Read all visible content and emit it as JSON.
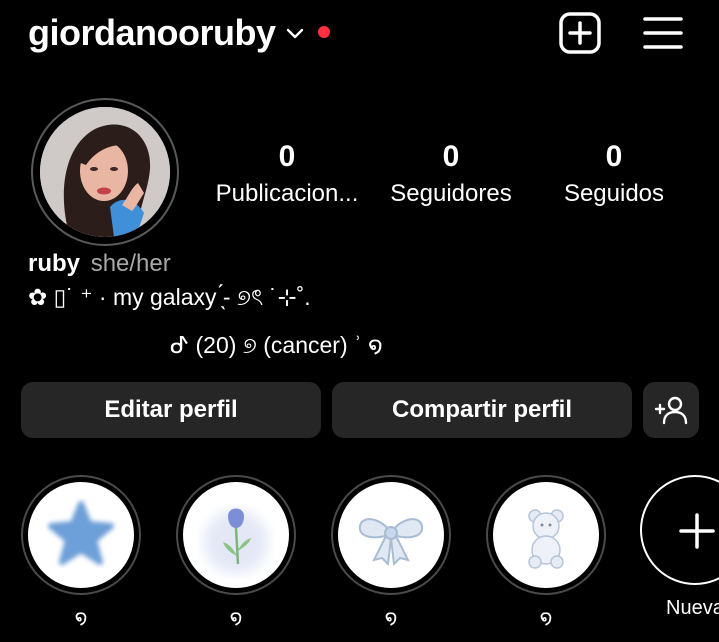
{
  "header": {
    "username": "giordanooruby",
    "icons": [
      "chevron-down-icon",
      "notification-dot",
      "add-post-icon",
      "menu-icon"
    ],
    "accent_color": "#ff3040"
  },
  "profile": {
    "stats": [
      {
        "value": "0",
        "label": "Publicacion..."
      },
      {
        "value": "0",
        "label": "Seguidores"
      },
      {
        "value": "0",
        "label": "Seguidos"
      }
    ],
    "bio": {
      "name": "ruby",
      "pronouns": "she/her",
      "line1": "✿ ▯˙ ⁺ · my galaxy ̖́- ୭ৎ ˙⊹˚.",
      "line2": "ᕷ (20) ୭ (cancer) ʾ ໑"
    }
  },
  "actions": {
    "edit_label": "Editar perfil",
    "share_label": "Compartir perfil",
    "add_user_icon": "add-person-icon"
  },
  "highlights": {
    "items": [
      {
        "label": "໑",
        "icon": "blue-star-icon"
      },
      {
        "label": "໑",
        "icon": "blue-tulip-icon"
      },
      {
        "label": "໑",
        "icon": "bow-icon"
      },
      {
        "label": "໑",
        "icon": "teddy-bear-icon"
      }
    ],
    "new_label": "Nueva",
    "new_icon": "plus-icon"
  },
  "colors": {
    "background": "#000000",
    "button_bg": "#262626",
    "secondary_text": "#a8a8a8",
    "highlight_blue": "#6d9fd8"
  }
}
